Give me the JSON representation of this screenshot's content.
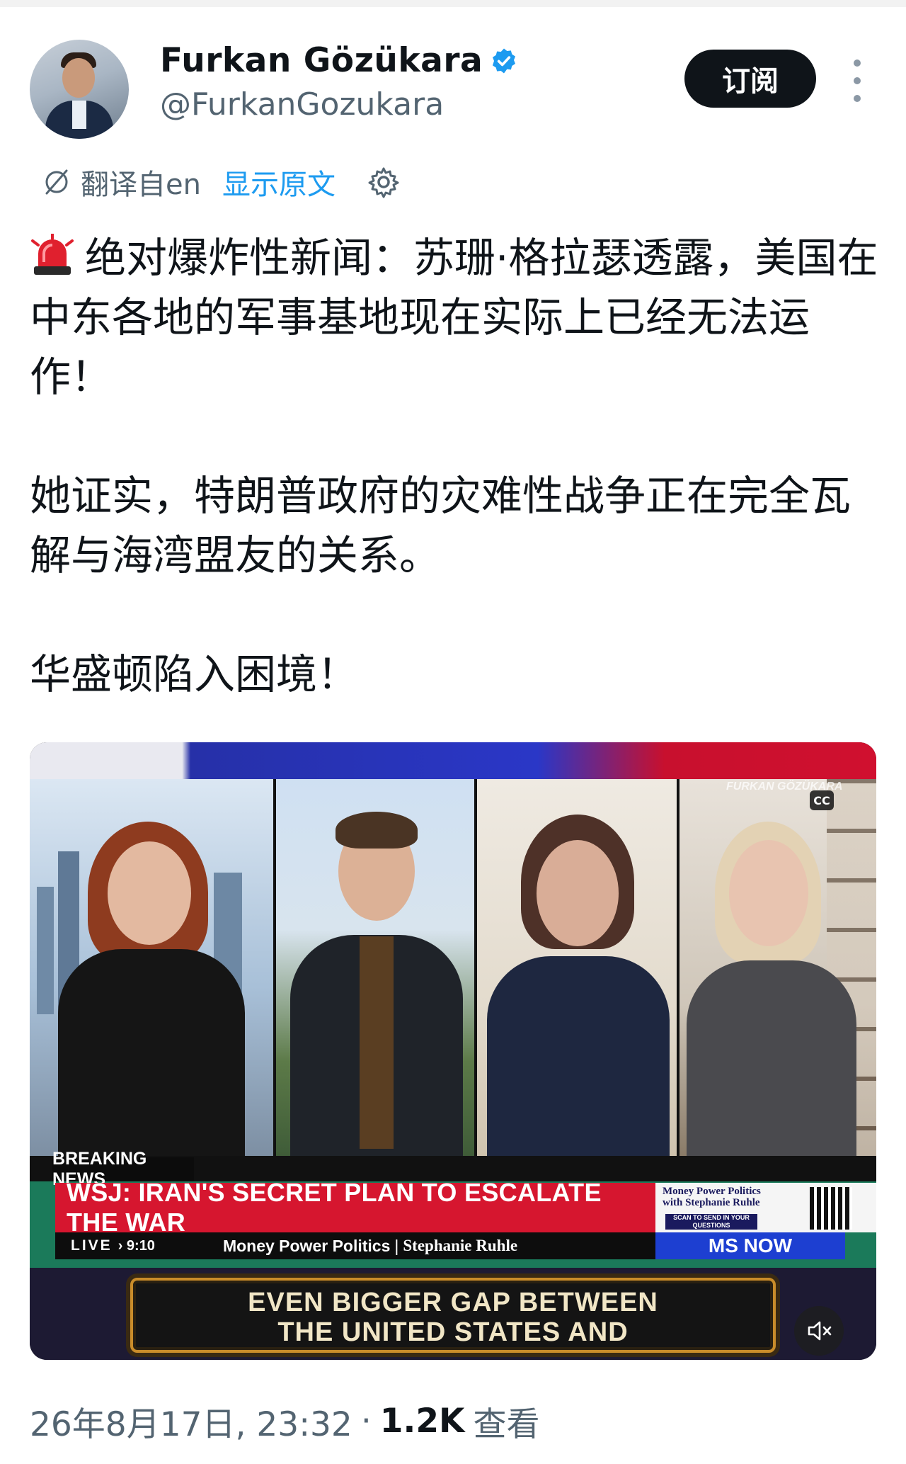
{
  "author": {
    "name": "Furkan Gözükara",
    "handle": "@FurkanGozukara",
    "verified": true
  },
  "actions": {
    "subscribe_label": "订阅",
    "more_icon": "more-vertical-icon"
  },
  "translation": {
    "from_label": "翻译自en",
    "show_original": "显示原文"
  },
  "tweet": {
    "paragraph1": "绝对爆炸性新闻：苏珊·格拉瑟透露，美国在中东各地的军事基地现在实际上已经无法运作！",
    "paragraph2": "她证实，特朗普政府的灾难性战争正在完全瓦解与海湾盟友的关系。",
    "paragraph3": "华盛顿陷入困境！"
  },
  "video": {
    "breaking_label": "BREAKING NEWS",
    "headline": "WSJ: IRAN'S SECRET PLAN TO ESCALATE THE WAR",
    "live_label": "LIVE",
    "time": "› 9:10",
    "program": "Money Power Politics",
    "host": "Stephanie Ruhle",
    "show_box_title": "Money Power Politics with Stephanie Ruhle",
    "scan_text": "SCAN TO SEND IN YOUR QUESTIONS",
    "network": "MS NOW",
    "watermark": "FURKAN GÖZÜKARA",
    "cc_label": "CC",
    "subtitle_line1": "EVEN BIGGER GAP BETWEEN",
    "subtitle_line2": "THE UNITED STATES AND"
  },
  "meta": {
    "datetime": "26年8月17日, 23:32",
    "separator": "·",
    "views": "1.2K",
    "views_label": "查看"
  },
  "colors": {
    "accent_blue": "#1d9bf0",
    "text_primary": "#0f1419",
    "text_secondary": "#536471",
    "headline_red": "#d6162f",
    "network_blue": "#1d3fd1"
  }
}
